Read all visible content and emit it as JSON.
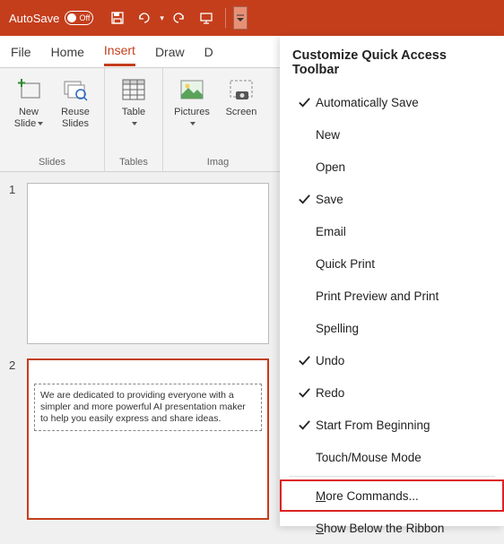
{
  "titlebar": {
    "autosave_label": "AutoSave",
    "autosave_state": "Off"
  },
  "tabs": {
    "items": [
      "File",
      "Home",
      "Insert",
      "Draw",
      "D"
    ],
    "active": "Insert"
  },
  "ribbon": {
    "slides": {
      "label": "Slides",
      "new_slide": "New\nSlide",
      "reuse_slides": "Reuse\nSlides"
    },
    "tables": {
      "label": "Tables",
      "table": "Table"
    },
    "images": {
      "label": "Imag",
      "pictures": "Pictures",
      "screenshot": "Screen"
    }
  },
  "thumbs": {
    "slide1_num": "1",
    "slide2_num": "2",
    "slide2_text": "We are dedicated to providing everyone with a simpler and more powerful AI presentation maker to help you easily express and share ideas."
  },
  "dropdown": {
    "title": "Customize Quick Access Toolbar",
    "items": [
      {
        "label": "Automatically Save",
        "checked": true
      },
      {
        "label": "New",
        "checked": false
      },
      {
        "label": "Open",
        "checked": false
      },
      {
        "label": "Save",
        "checked": true
      },
      {
        "label": "Email",
        "checked": false
      },
      {
        "label": "Quick Print",
        "checked": false
      },
      {
        "label": "Print Preview and Print",
        "checked": false
      },
      {
        "label": "Spelling",
        "checked": false
      },
      {
        "label": "Undo",
        "checked": true
      },
      {
        "label": "Redo",
        "checked": true
      },
      {
        "label": "Start From Beginning",
        "checked": true
      },
      {
        "label": "Touch/Mouse Mode",
        "checked": false
      }
    ],
    "more_commands": "ore Commands...",
    "more_commands_m": "M",
    "show_below": "how Below the Ribbon",
    "show_below_s": "S"
  }
}
